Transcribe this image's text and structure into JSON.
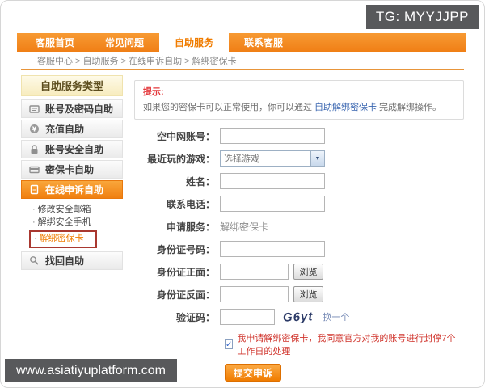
{
  "badge": {
    "text": "TG: MYYJJPP"
  },
  "nav": {
    "tabs": [
      {
        "label": "客服首页",
        "active": false
      },
      {
        "label": "常见问题",
        "active": false
      },
      {
        "label": "自助服务",
        "active": true
      },
      {
        "label": "联系客服",
        "active": false
      }
    ]
  },
  "breadcrumb": {
    "text": "客服中心 > 自助服务 > 在线申诉自助 > 解绑密保卡"
  },
  "sidebar": {
    "title": "自助服务类型",
    "items": [
      {
        "label": "账号及密码自助",
        "icon": "id-card-icon"
      },
      {
        "label": "充值自助",
        "icon": "yen-coin-icon"
      },
      {
        "label": "账号安全自助",
        "icon": "lock-icon"
      },
      {
        "label": "密保卡自助",
        "icon": "card-icon"
      },
      {
        "label": "在线申诉自助",
        "icon": "appeal-doc-icon",
        "active": true
      },
      {
        "label": "找回自助",
        "icon": "magnifier-icon"
      }
    ],
    "subitems": [
      {
        "label": "修改安全邮箱",
        "highlighted": false
      },
      {
        "label": "解绑安全手机",
        "highlighted": false
      },
      {
        "label": "解绑密保卡",
        "highlighted": true
      }
    ],
    "bullet": "·"
  },
  "tip": {
    "title": "提示:",
    "text_before": "如果您的密保卡可以正常使用，你可以通过",
    "link": "自助解绑密保卡",
    "text_after": "完成解绑操作。"
  },
  "form": {
    "account_label": "空中网账号：",
    "account_value": "",
    "game_label": "最近玩的游戏：",
    "game_value": "选择游戏",
    "name_label": "姓名：",
    "name_value": "",
    "phone_label": "联系电话：",
    "phone_value": "",
    "service_label": "申请服务：",
    "service_value": "解绑密保卡",
    "id_number_label": "身份证号码：",
    "id_number_value": "",
    "id_front_label": "身份证正面：",
    "id_front_value": "",
    "id_back_label": "身份证反面：",
    "id_back_value": "",
    "browse_label": "浏览",
    "captcha_label": "验证码：",
    "captcha_value": "",
    "captcha_image_text": "G6yt",
    "captcha_refresh_label": "换一个",
    "agree_checked": true,
    "agree_check_glyph": "✓",
    "agree_text": "我申请解绑密保卡，我同意官方对我的账号进行封停7个工作日的处理",
    "submit_label": "提交申诉"
  },
  "watermark": {
    "text": "www.asiatiyuplatform.com"
  },
  "colors": {
    "accent_orange": "#F07C00",
    "nav_orange": "#F5821F",
    "tip_red": "#E4393C",
    "agree_red": "#D0342C",
    "link_blue": "#3A66B0",
    "highlight_border_red": "#A93830",
    "badge_gray": "#58595B"
  }
}
